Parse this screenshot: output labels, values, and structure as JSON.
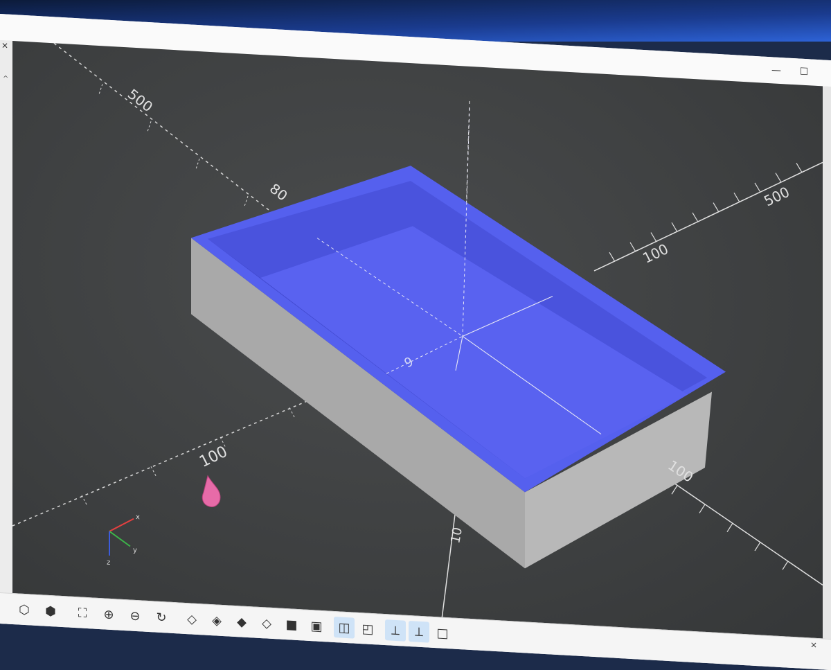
{
  "window": {
    "minimize_label": "—",
    "maximize_label": "☐",
    "side_close_label": "×",
    "side_arrow_label": "^",
    "panel_close_label": "×"
  },
  "viewport": {
    "scale_labels": [
      "500",
      "80",
      "100",
      "500",
      "100",
      "100",
      "10",
      "9"
    ],
    "axis_indicator": {
      "x": "x",
      "y": "y",
      "z": "z"
    }
  },
  "toolbar": {
    "tools": [
      {
        "name": "preview-icon",
        "glyph": "⬡"
      },
      {
        "name": "render-icon",
        "glyph": "⬢"
      },
      {
        "name": "view-all-icon",
        "glyph": "⛶"
      },
      {
        "name": "zoom-in-icon",
        "glyph": "⊕"
      },
      {
        "name": "zoom-out-icon",
        "glyph": "⊖"
      },
      {
        "name": "reset-view-icon",
        "glyph": "↻"
      },
      {
        "name": "view-right-icon",
        "glyph": "◇"
      },
      {
        "name": "view-top-icon",
        "glyph": "◈"
      },
      {
        "name": "view-bottom-icon",
        "glyph": "◆"
      },
      {
        "name": "view-left-icon",
        "glyph": "◇"
      },
      {
        "name": "view-front-icon",
        "glyph": "■"
      },
      {
        "name": "view-back-icon",
        "glyph": "▣"
      },
      {
        "name": "perspective-icon",
        "glyph": "◫"
      },
      {
        "name": "orthogonal-icon",
        "glyph": "◰"
      },
      {
        "name": "show-axes-icon",
        "glyph": "⟂"
      },
      {
        "name": "show-scale-icon",
        "glyph": "⟂"
      },
      {
        "name": "show-edges-icon",
        "glyph": "□"
      }
    ]
  }
}
